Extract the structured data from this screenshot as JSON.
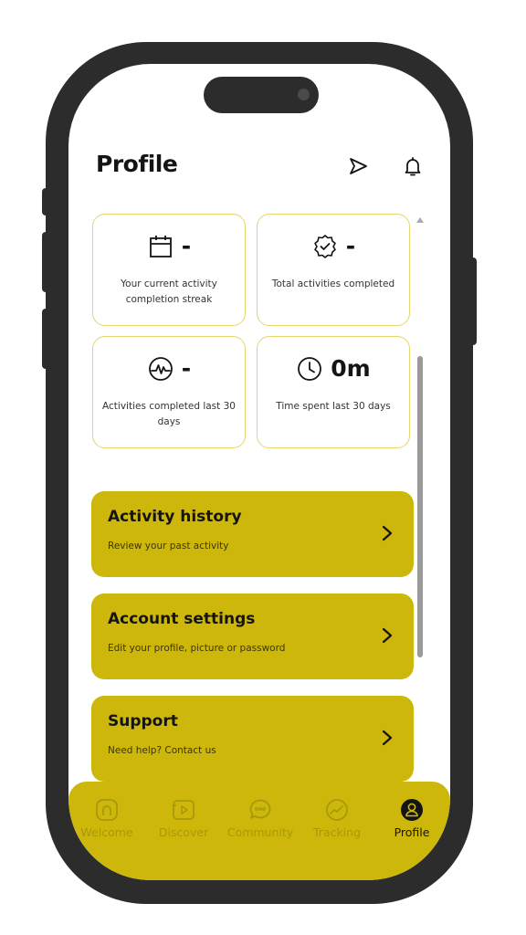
{
  "header": {
    "title": "Profile",
    "send_icon": "send-icon",
    "bell_icon": "bell-icon"
  },
  "stats": [
    {
      "icon": "calendar-icon",
      "value": "-",
      "label": "Your current activity completion streak"
    },
    {
      "icon": "badge-icon",
      "value": "-",
      "label": "Total activities completed"
    },
    {
      "icon": "activity-icon",
      "value": "-",
      "label": "Activities completed last 30 days"
    },
    {
      "icon": "clock-icon",
      "value": "0m",
      "label": "Time spent last 30 days"
    }
  ],
  "menu": [
    {
      "title": "Activity history",
      "subtitle": "Review your past activity",
      "icon": "chevron-right-icon"
    },
    {
      "title": "Account settings",
      "subtitle": "Edit your profile, picture or password",
      "icon": "chevron-right-icon"
    },
    {
      "title": "Support",
      "subtitle": "Need help? Contact us",
      "icon": "chevron-right-icon"
    }
  ],
  "tabs": [
    {
      "label": "Welcome",
      "icon": "home-icon",
      "active": false
    },
    {
      "label": "Discover",
      "icon": "play-icon",
      "active": false
    },
    {
      "label": "Community",
      "icon": "chat-icon",
      "active": false
    },
    {
      "label": "Tracking",
      "icon": "tracking-icon",
      "active": false
    },
    {
      "label": "Profile",
      "icon": "profile-icon",
      "active": true
    }
  ],
  "colors": {
    "accent": "#ccb70a",
    "card_border": "#e6d56a",
    "frame": "#2c2c2c",
    "inactive_tab": "#a8990a"
  }
}
